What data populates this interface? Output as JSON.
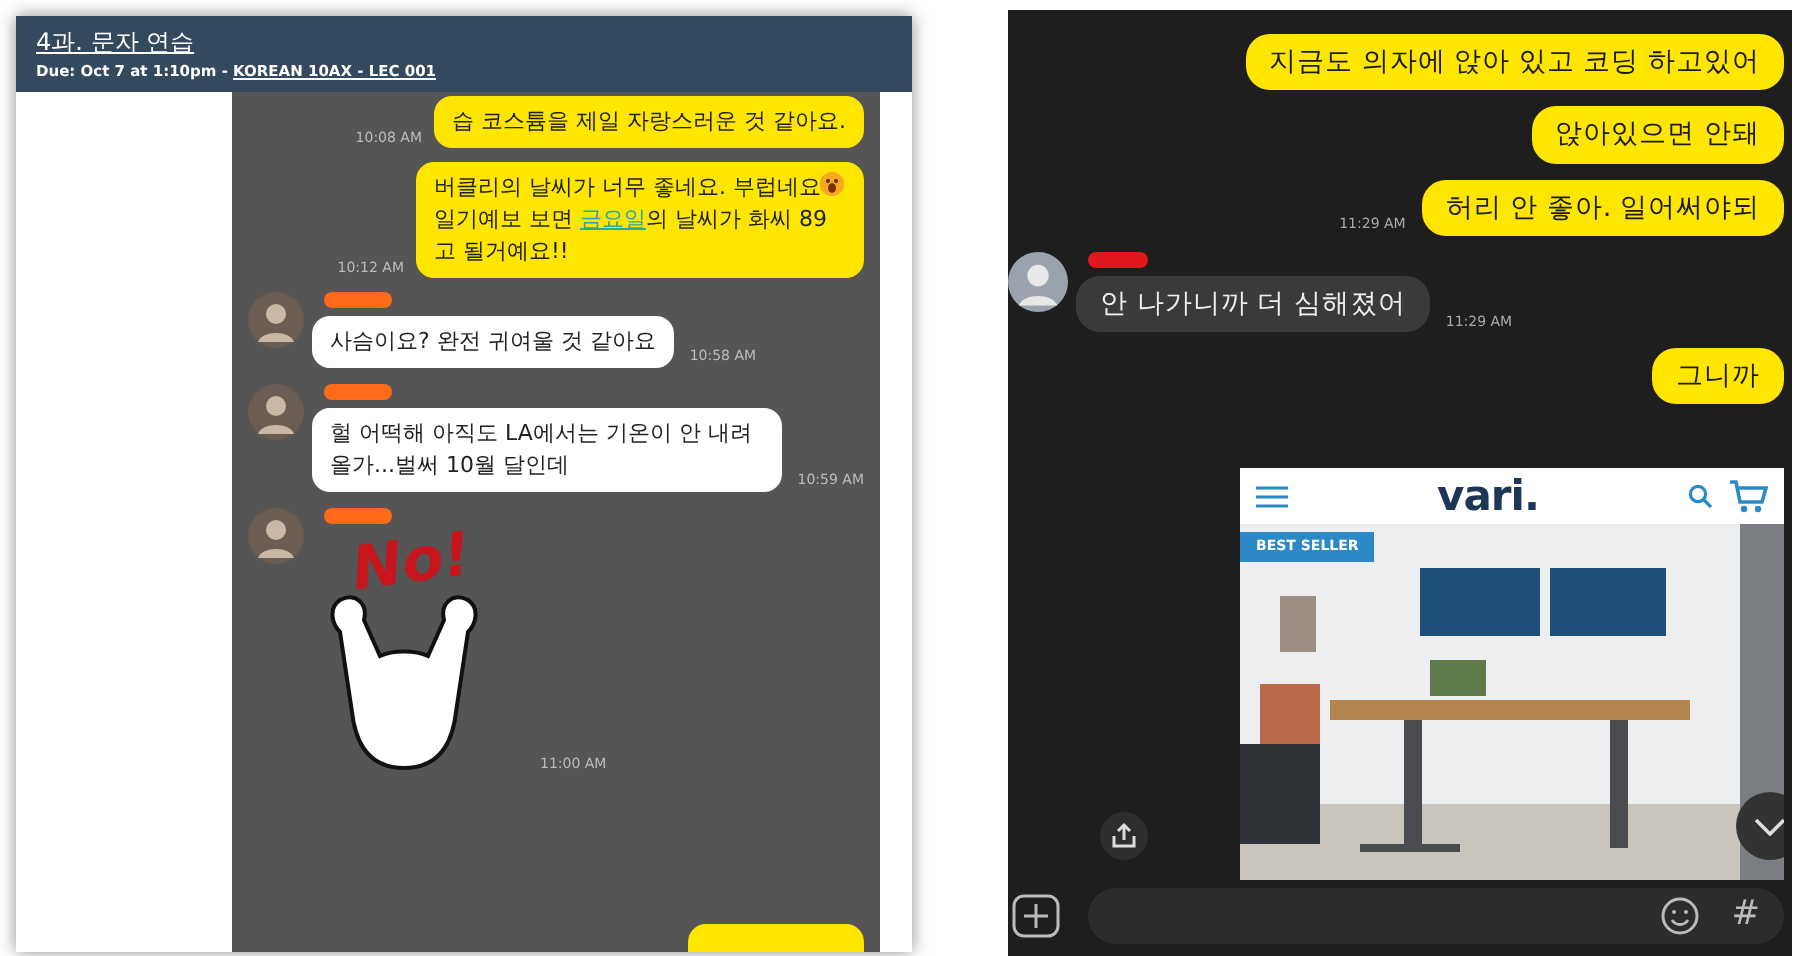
{
  "assignment": {
    "title": "4과. 문자 연습",
    "due": "Due: Oct 7 at 1:10pm - ",
    "course_link": "KOREAN 10AX - LEC 001"
  },
  "left_chat": {
    "messages": [
      {
        "kind": "sent",
        "parts": [
          {
            "kind": "text",
            "text": "습 코스튬을 제일 자랑스러운 것 같아요."
          }
        ],
        "time": "10:08 AM"
      },
      {
        "kind": "sent",
        "parts": [
          {
            "kind": "text",
            "text": "버클리의 날씨가 너무 좋네요. 부럽네요"
          },
          {
            "kind": "emoji"
          },
          {
            "kind": "text",
            "text": " 일기예보 보면 "
          },
          {
            "kind": "link",
            "text": "금요일"
          },
          {
            "kind": "text",
            "text": "의 날씨가 화씨 89고 될거예요!!"
          }
        ],
        "time": "10:12 AM"
      },
      {
        "kind": "received",
        "parts": [
          {
            "kind": "text",
            "text": "사슴이요? 완전 귀여울 것 같아요"
          }
        ],
        "time": "10:58 AM"
      },
      {
        "kind": "received",
        "parts": [
          {
            "kind": "text",
            "text": "헐 어떡해 아직도 LA에서는 기온이 안 내려올가...벌써 10월 달인데"
          }
        ],
        "time": "10:59 AM"
      },
      {
        "kind": "sticker",
        "sticker_text": "No!",
        "time": "11:00 AM"
      },
      {
        "kind": "partial"
      }
    ]
  },
  "right_chat": {
    "messages": [
      {
        "kind": "sent",
        "text": "지금도 의자에 앉아 있고 코딩 하고있어"
      },
      {
        "kind": "sent",
        "text": "앉아있으면 안돼"
      },
      {
        "kind": "sent",
        "text": "허리 안 좋아. 일어써야되",
        "time": "11:29 AM"
      },
      {
        "kind": "received",
        "text": "안 나가니까 더 심해졌어",
        "time": "11:29 AM"
      },
      {
        "kind": "sent",
        "text": "그니까"
      },
      {
        "kind": "preview",
        "logo": "vari.",
        "badge": "BEST SELLER"
      }
    ],
    "input_bar": {
      "hash": "#"
    }
  }
}
